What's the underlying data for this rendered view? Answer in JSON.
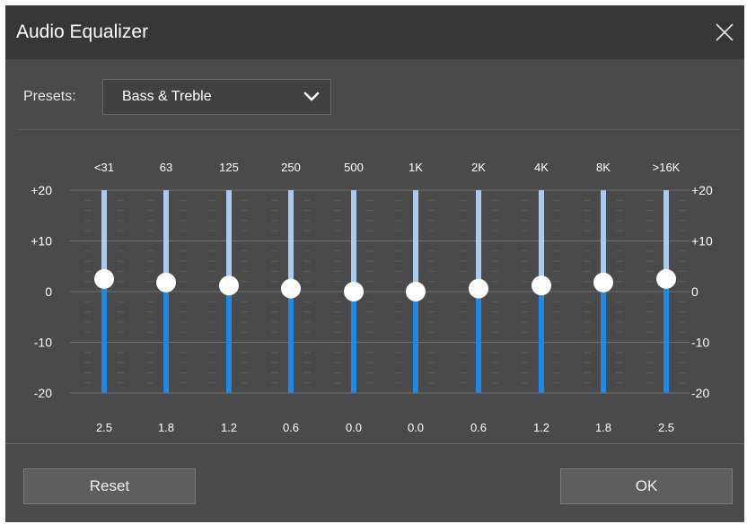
{
  "window": {
    "title": "Audio Equalizer",
    "close_icon": "close-icon"
  },
  "presets": {
    "label": "Presets:",
    "selected": "Bass & Treble",
    "dropdown_icon": "chevron-down-icon"
  },
  "equalizer": {
    "scale_left": [
      "+20",
      "+10",
      "0",
      "-10",
      "-20"
    ],
    "scale_right": [
      "+20",
      "+10",
      "0",
      "-10",
      "-20"
    ],
    "range_db": [
      -20,
      20
    ],
    "bands": [
      {
        "freq": "<31",
        "value": 2.5,
        "value_label": "2.5"
      },
      {
        "freq": "63",
        "value": 1.8,
        "value_label": "1.8"
      },
      {
        "freq": "125",
        "value": 1.2,
        "value_label": "1.2"
      },
      {
        "freq": "250",
        "value": 0.6,
        "value_label": "0.6"
      },
      {
        "freq": "500",
        "value": 0.0,
        "value_label": "0.0"
      },
      {
        "freq": "1K",
        "value": 0.0,
        "value_label": "0.0"
      },
      {
        "freq": "2K",
        "value": 0.6,
        "value_label": "0.6"
      },
      {
        "freq": "4K",
        "value": 1.2,
        "value_label": "1.2"
      },
      {
        "freq": "8K",
        "value": 1.8,
        "value_label": "1.8"
      },
      {
        "freq": ">16K",
        "value": 2.5,
        "value_label": "2.5"
      }
    ],
    "colors": {
      "upper_track": "#a9cbef",
      "lower_track": "#1e88e5",
      "knob": "#ffffff",
      "grid": "#6e6e6e",
      "label": "#ffffff"
    }
  },
  "buttons": {
    "reset": "Reset",
    "ok": "OK"
  }
}
